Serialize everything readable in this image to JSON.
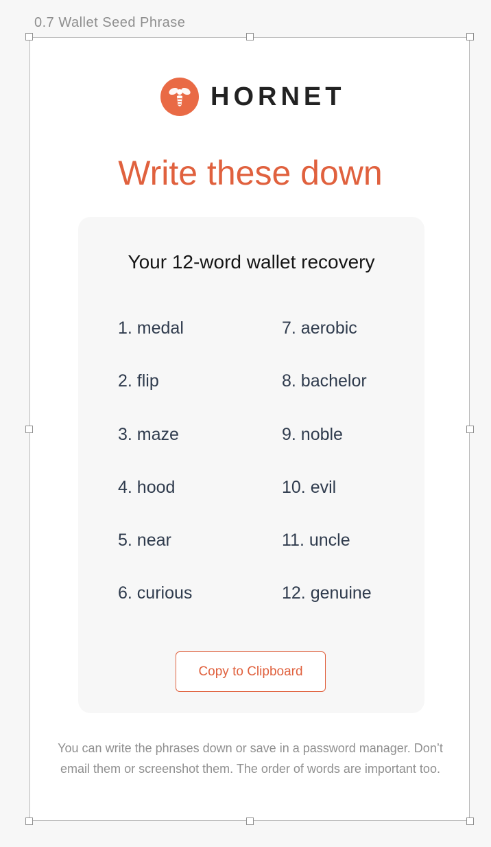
{
  "artboard": {
    "label": "0.7 Wallet Seed Phrase"
  },
  "brand": {
    "name": "HORNET",
    "icon": "hornet-icon",
    "accent_color": "#e96a45"
  },
  "headline": "Write these down",
  "card": {
    "title": "Your 12-word wallet recovery",
    "words": [
      "1. medal",
      "2. flip",
      "3. maze",
      "4. hood",
      "5. near",
      "6. curious",
      "7. aerobic",
      "8. bachelor",
      "9. noble",
      "10. evil",
      "11. uncle",
      "12. genuine"
    ],
    "copy_button": "Copy to Clipboard"
  },
  "footer_note": "You can write the phrases down or save in a password manager. Don’t email them or screenshot them. The order of words are important too."
}
